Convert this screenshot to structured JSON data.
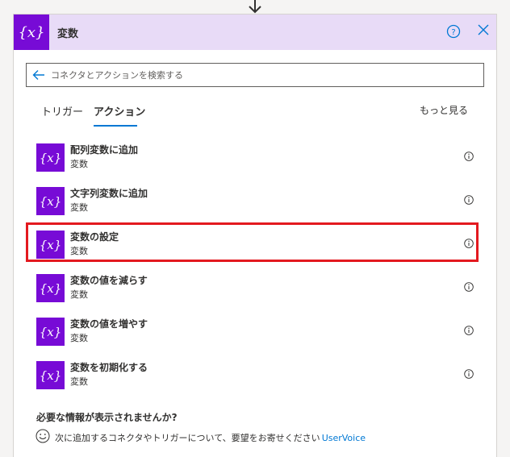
{
  "header": {
    "title": "変数",
    "icon_glyph": "{x}",
    "accent": "#770bd6",
    "background": "#e8dbf7"
  },
  "search": {
    "placeholder": "コネクタとアクションを検索する",
    "value": ""
  },
  "tabs": [
    {
      "label": "トリガー",
      "active": false
    },
    {
      "label": "アクション",
      "active": true
    }
  ],
  "see_more": "もっと見る",
  "actions": [
    {
      "name": "配列変数に追加",
      "connector": "変数"
    },
    {
      "name": "文字列変数に追加",
      "connector": "変数"
    },
    {
      "name": "変数の設定",
      "connector": "変数",
      "highlighted": true
    },
    {
      "name": "変数の値を減らす",
      "connector": "変数"
    },
    {
      "name": "変数の値を増やす",
      "connector": "変数"
    },
    {
      "name": "変数を初期化する",
      "connector": "変数"
    }
  ],
  "footer": {
    "title": "必要な情報が表示されませんか?",
    "message": "次に追加するコネクタやトリガーについて、要望をお寄せください",
    "link": "UserVoice"
  },
  "colors": {
    "highlight": "#e3191f",
    "link": "#0078d4"
  }
}
